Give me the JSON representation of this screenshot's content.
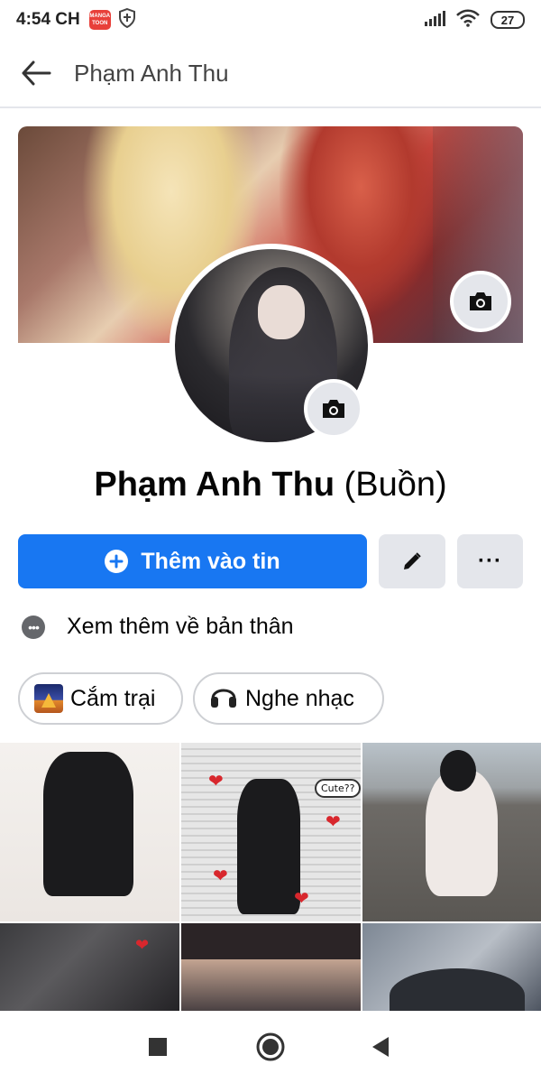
{
  "status_bar": {
    "time": "4:54 CH",
    "app_badge_line1": "MANGA",
    "app_badge_line2": "TOON",
    "battery": "27"
  },
  "header": {
    "title": "Phạm Anh Thu"
  },
  "profile": {
    "name": "Phạm Anh Thu",
    "status": "(Buồn)"
  },
  "actions": {
    "add_story_label": "Thêm vào tin",
    "more_label": "···"
  },
  "about": {
    "label": "Xem thêm về bản thân",
    "dots": "•••"
  },
  "hobbies": [
    {
      "label": "Cắm trại",
      "icon": "camping-icon"
    },
    {
      "label": "Nghe nhạc",
      "icon": "headphones-icon"
    }
  ],
  "photos": {
    "speech_bubble": "Cute??"
  },
  "colors": {
    "accent": "#1877f2",
    "secondary_button": "#e4e6eb",
    "text": "#050505"
  }
}
